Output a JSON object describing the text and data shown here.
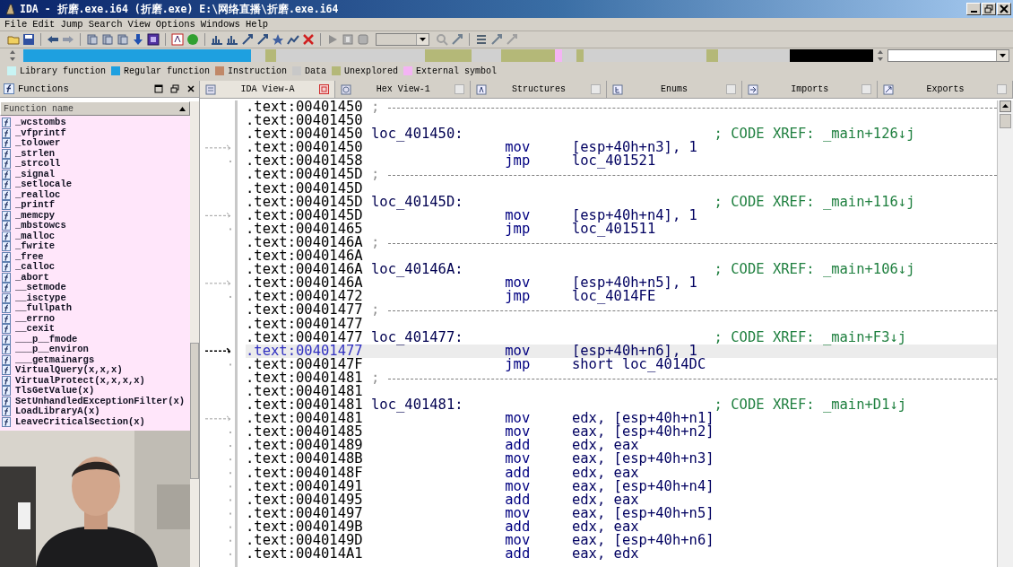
{
  "window": {
    "title": "IDA - 折磨.exe.i64 (折磨.exe) E:\\网络直播\\折磨.exe.i64"
  },
  "menu": [
    "File",
    "Edit",
    "Jump",
    "Search",
    "View",
    "Options",
    "Windows",
    "Help"
  ],
  "legend": [
    {
      "label": "Library function",
      "color": "#c8f4f4"
    },
    {
      "label": "Regular function",
      "color": "#1ea0e0"
    },
    {
      "label": "Instruction",
      "color": "#c08868"
    },
    {
      "label": "Data",
      "color": "#c8c8c8"
    },
    {
      "label": "Unexplored",
      "color": "#b4b878"
    },
    {
      "label": "External symbol",
      "color": "#f4b4f4"
    }
  ],
  "functions_panel": {
    "title": "Functions",
    "column": "Function name",
    "items": [
      "_wcstombs",
      "_vfprintf",
      "_tolower",
      "_strlen",
      "_strcoll",
      "_signal",
      "_setlocale",
      "_realloc",
      "_printf",
      "_memcpy",
      "_mbstowcs",
      "_malloc",
      "_fwrite",
      "_free",
      "_calloc",
      "_abort",
      "__setmode",
      "__isctype",
      "__fullpath",
      "__errno",
      "__cexit",
      "___p__fmode",
      "___p__environ",
      "___getmainargs",
      "VirtualQuery(x,x,x)",
      "VirtualProtect(x,x,x,x)",
      "TlsGetValue(x)",
      "SetUnhandledExceptionFilter(x)",
      "LoadLibraryA(x)",
      "LeaveCriticalSection(x)"
    ]
  },
  "tabs": [
    {
      "label": "IDA View-A",
      "selected": true
    },
    {
      "label": "Hex View-1",
      "selected": false
    },
    {
      "label": "Structures",
      "selected": false
    },
    {
      "label": "Enums",
      "selected": false
    },
    {
      "label": "Imports",
      "selected": false
    },
    {
      "label": "Exports",
      "selected": false
    }
  ],
  "listing": {
    "lines": [
      {
        "kind": "separator",
        "address": ".text:00401450",
        "text": ";",
        "selected": false
      },
      {
        "kind": "blank",
        "address": ".text:00401450",
        "selected": false
      },
      {
        "kind": "label",
        "address": ".text:00401450",
        "label": "loc_401450:",
        "comment": "; CODE XREF: _main+126↓j",
        "selected": false
      },
      {
        "kind": "insn",
        "address": ".text:00401450",
        "mnemonic": "mov",
        "operand": "[esp+40h+n3], 1",
        "selected": false
      },
      {
        "kind": "insn",
        "address": ".text:00401458",
        "mnemonic": "jmp",
        "operand": "loc_401521",
        "selected": false
      },
      {
        "kind": "separator",
        "address": ".text:0040145D",
        "text": ";",
        "selected": false
      },
      {
        "kind": "blank",
        "address": ".text:0040145D",
        "selected": false
      },
      {
        "kind": "label",
        "address": ".text:0040145D",
        "label": "loc_40145D:",
        "comment": "; CODE XREF: _main+116↓j",
        "selected": false
      },
      {
        "kind": "insn",
        "address": ".text:0040145D",
        "mnemonic": "mov",
        "operand": "[esp+40h+n4], 1",
        "selected": false
      },
      {
        "kind": "insn",
        "address": ".text:00401465",
        "mnemonic": "jmp",
        "operand": "loc_401511",
        "selected": false
      },
      {
        "kind": "separator",
        "address": ".text:0040146A",
        "text": ";",
        "selected": false
      },
      {
        "kind": "blank",
        "address": ".text:0040146A",
        "selected": false
      },
      {
        "kind": "label",
        "address": ".text:0040146A",
        "label": "loc_40146A:",
        "comment": "; CODE XREF: _main+106↓j",
        "selected": false
      },
      {
        "kind": "insn",
        "address": ".text:0040146A",
        "mnemonic": "mov",
        "operand": "[esp+40h+n5], 1",
        "selected": false
      },
      {
        "kind": "insn",
        "address": ".text:00401472",
        "mnemonic": "jmp",
        "operand": "loc_4014FE",
        "selected": false
      },
      {
        "kind": "separator",
        "address": ".text:00401477",
        "text": ";",
        "selected": false
      },
      {
        "kind": "blank",
        "address": ".text:00401477",
        "selected": false
      },
      {
        "kind": "label",
        "address": ".text:00401477",
        "label": "loc_401477:",
        "comment": "; CODE XREF: _main+F3↓j",
        "selected": false
      },
      {
        "kind": "insn",
        "address": ".text:00401477",
        "mnemonic": "mov",
        "operand": "[esp+40h+n6], 1",
        "selected": true
      },
      {
        "kind": "insn",
        "address": ".text:0040147F",
        "mnemonic": "jmp",
        "operand": "short loc_4014DC",
        "selected": false
      },
      {
        "kind": "separator",
        "address": ".text:00401481",
        "text": ";",
        "selected": false
      },
      {
        "kind": "blank",
        "address": ".text:00401481",
        "selected": false
      },
      {
        "kind": "label",
        "address": ".text:00401481",
        "label": "loc_401481:",
        "comment": "; CODE XREF: _main+D1↓j",
        "selected": false
      },
      {
        "kind": "insn",
        "address": ".text:00401481",
        "mnemonic": "mov",
        "operand": "edx, [esp+40h+n1]",
        "selected": false
      },
      {
        "kind": "insn",
        "address": ".text:00401485",
        "mnemonic": "mov",
        "operand": "eax, [esp+40h+n2]",
        "selected": false
      },
      {
        "kind": "insn",
        "address": ".text:00401489",
        "mnemonic": "add",
        "operand": "edx, eax",
        "selected": false
      },
      {
        "kind": "insn",
        "address": ".text:0040148B",
        "mnemonic": "mov",
        "operand": "eax, [esp+40h+n3]",
        "selected": false
      },
      {
        "kind": "insn",
        "address": ".text:0040148F",
        "mnemonic": "add",
        "operand": "edx, eax",
        "selected": false
      },
      {
        "kind": "insn",
        "address": ".text:00401491",
        "mnemonic": "mov",
        "operand": "eax, [esp+40h+n4]",
        "selected": false
      },
      {
        "kind": "insn",
        "address": ".text:00401495",
        "mnemonic": "add",
        "operand": "edx, eax",
        "selected": false
      },
      {
        "kind": "insn",
        "address": ".text:00401497",
        "mnemonic": "mov",
        "operand": "eax, [esp+40h+n5]",
        "selected": false
      },
      {
        "kind": "insn",
        "address": ".text:0040149B",
        "mnemonic": "add",
        "operand": "edx, eax",
        "selected": false
      },
      {
        "kind": "insn",
        "address": ".text:0040149D",
        "mnemonic": "mov",
        "operand": "eax, [esp+40h+n6]",
        "selected": false
      },
      {
        "kind": "insn",
        "address": ".text:004014A1",
        "mnemonic": "add",
        "operand": "eax, edx",
        "selected": false
      }
    ]
  }
}
